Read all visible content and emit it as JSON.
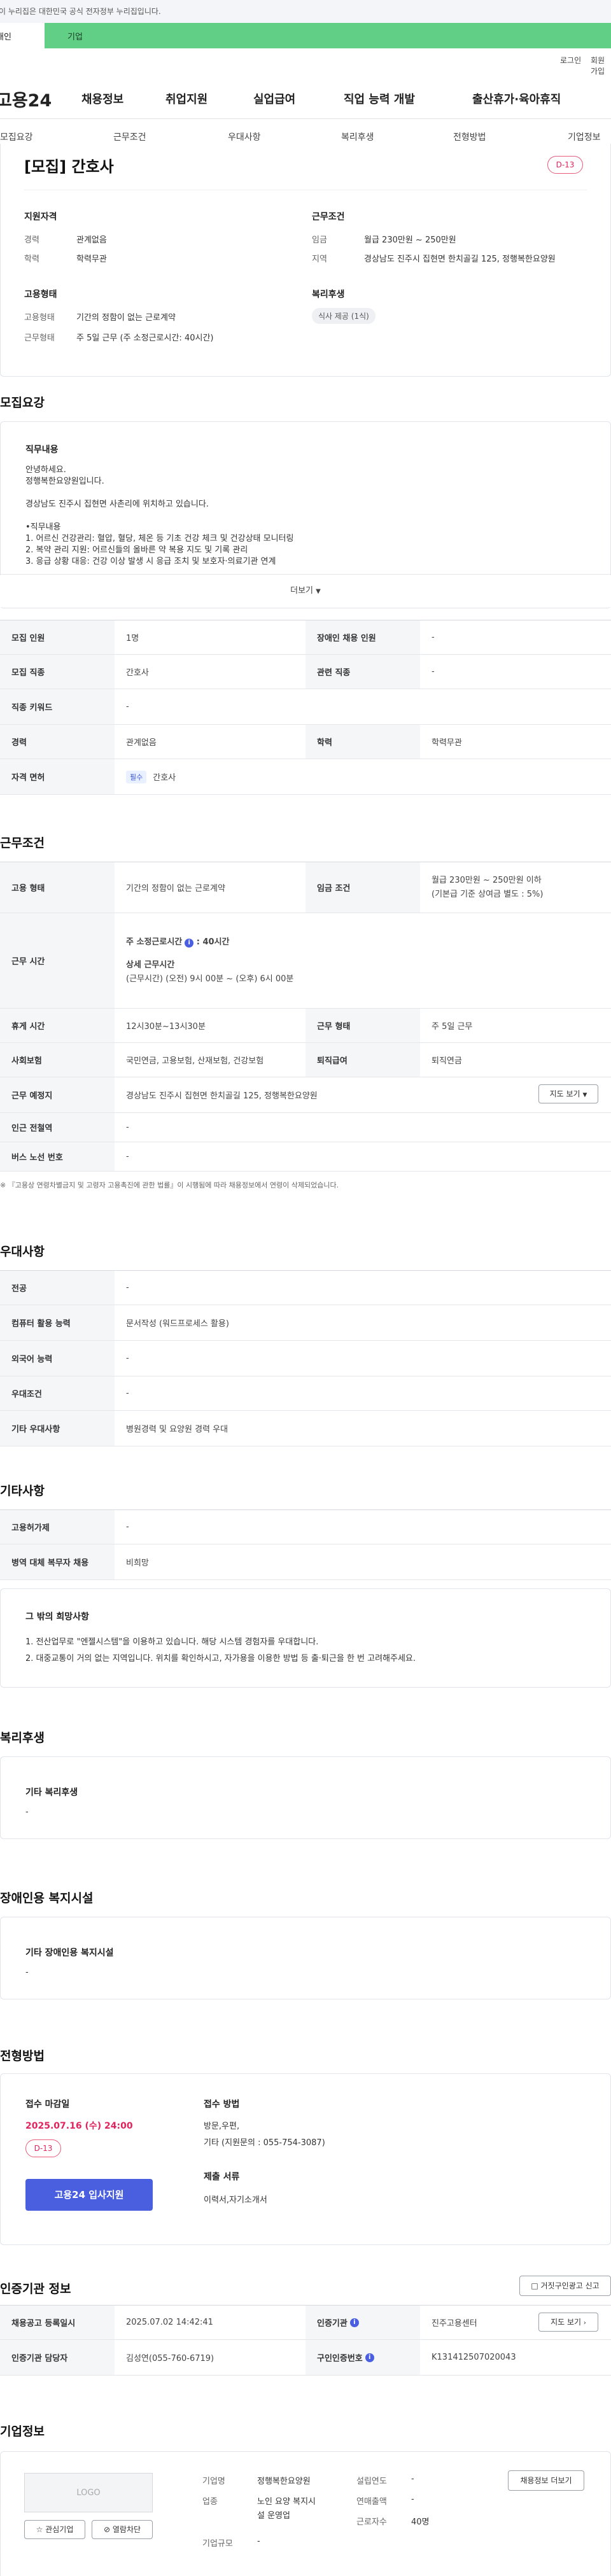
{
  "gov_bar": {
    "text": "이 누리집은 대한민국 공식 전자정부 누리집입니다."
  },
  "top_tabs": {
    "personal": "개인",
    "company": "기업"
  },
  "util_links": {
    "login": "로그인",
    "join": "회원가입"
  },
  "header": {
    "logo": "고용24",
    "gnb": [
      "채용정보",
      "취업지원",
      "실업급여",
      "직업 능력 개발",
      "출산휴가·육아휴직"
    ]
  },
  "subnav": [
    "모집요강",
    "근무조건",
    "우대사항",
    "복리후생",
    "전형방법",
    "기업정보"
  ],
  "summary": {
    "title": "[모집] 간호사",
    "dday": "D-13",
    "qualification_title": "지원자격",
    "career_label": "경력",
    "career_value": "관계없음",
    "edu_label": "학력",
    "edu_value": "학력무관",
    "work_title": "근무조건",
    "wage_label": "임금",
    "wage_value": "월급 230만원 ~ 250만원",
    "region_label": "지역",
    "region_value": "경상남도 진주시 집현면 한치골길 125, 정행복한요양원",
    "employ_title": "고용형태",
    "employ_type_label": "고용형태",
    "employ_type_value": "기간의 정함이 없는 근로계약",
    "work_form_label": "근무형태",
    "work_form_value": "주 5일 근무 (주 소정근로시간: 40시간)",
    "welfare_title": "복리후생",
    "welfare_tag": "식사 제공 (1식)"
  },
  "recruit": {
    "section_title": "모집요강",
    "job_content_title": "직무내용",
    "job_lines": [
      "안녕하세요.",
      "정행복한요양원입니다.",
      "",
      "경상남도 진주시 집현면 사촌리에 위치하고 있습니다.",
      "",
      "•직무내용",
      "1. 어르신 건강관리: 혈압, 혈당, 체온 등 기초 건강 체크 및 건강상태 모니터링",
      "2. 복약 관리 지원: 어르신들의 올바른 약 복용 지도 및 기록 관리",
      "3. 응급 상황 대응: 건강 이상 발생 시 응급 조치 및 보호자·의료기관 연계"
    ],
    "more_label": "더보기",
    "table": [
      {
        "h1": "모집 인원",
        "v1": "1명",
        "h2": "장애인 채용 인원",
        "v2": "-"
      },
      {
        "h1": "모집 직종",
        "v1": "간호사",
        "h2": "관련 직종",
        "v2": "-"
      },
      {
        "h1": "직종 키워드",
        "v1": "-"
      },
      {
        "h1": "경력",
        "v1": "관계없음",
        "h2": "학력",
        "v2": "학력무관"
      },
      {
        "h1": "자격 면허",
        "v1": "간호사",
        "badge": "필수"
      }
    ]
  },
  "conditions": {
    "section_title": "근무조건",
    "employ_form_h": "고용 형태",
    "employ_form_v": "기간의 정함이 없는 근로계약",
    "wage_h": "임금 조건",
    "wage_v1": "월급 230만원 ~ 250만원 이하",
    "wage_v2": "(기본급 기준 상여금 별도 : 5%)",
    "time_h": "근무 시간",
    "time_v1": "주 소정근로시간",
    "time_v1b": ": 40시간",
    "time_v2": "상세 근무시간",
    "time_v3": "(근무시간) (오전) 9시 00분 ~ (오후) 6시 00분",
    "rest_h": "휴게 시간",
    "rest_v": "12시30분~13시30분",
    "form_h": "근무 형태",
    "form_v": "주 5일 근무",
    "insure_h": "사회보험",
    "insure_v": "국민연금, 고용보험, 산재보험, 건강보험",
    "retire_h": "퇴직급여",
    "retire_v": "퇴직연금",
    "place_h": "근무 예정지",
    "place_v": "경상남도 진주시 집현면 한치골길 125, 정행복한요양원",
    "map_btn": "지도 보기",
    "station_h": "인근 전철역",
    "station_v": "-",
    "bus_h": "버스 노선 번호",
    "bus_v": "-",
    "note": "※ 『고용상 연령차별금지 및 고령자 고용촉진에 관한 법률』이 시행됨에 따라 채용정보에서 연령이 삭제되었습니다."
  },
  "preference": {
    "section_title": "우대사항",
    "rows": [
      {
        "h": "전공",
        "v": "-"
      },
      {
        "h": "컴퓨터 활용 능력",
        "v": "문서작성 (워드프로세스 활용)"
      },
      {
        "h": "외국어 능력",
        "v": "-"
      },
      {
        "h": "우대조건",
        "v": "-"
      },
      {
        "h": "기타 우대사항",
        "v": "병원경력 및 요양원 경력 우대"
      }
    ]
  },
  "etc": {
    "section_title": "기타사항",
    "rows": [
      {
        "h": "고용허가제",
        "v": "-"
      },
      {
        "h": "병역 대체 복무자 채용",
        "v": "비희망"
      }
    ],
    "box_title": "그 밖의 희망사항",
    "box_lines": [
      "1. 전산업무로 \"엔젤시스템\"을 이용하고 있습니다. 해당 시스템 경험자를 우대합니다.",
      "2. 대중교통이 거의 없는 지역입니다. 위치를 확인하시고, 자가용을 이용한 방법 등 출·퇴근을 한 번 고려해주세요."
    ]
  },
  "welfare": {
    "section_title": "복리후생",
    "box_title": "기타 복리후생",
    "box_value": "-"
  },
  "disability": {
    "section_title": "장애인용 복지시설",
    "box_title": "기타 장애인용 복지시설",
    "box_value": "-"
  },
  "selection": {
    "section_title": "전형방법",
    "deadline_label": "접수 마감일",
    "deadline_value": "2025.07.16 (수) 24:00",
    "dday": "D-13",
    "apply_btn": "고용24 입사지원",
    "method_label": "접수 방법",
    "method_v1": "방문,우편,",
    "method_v2": "기타 (지원문의 : 055-754-3087)",
    "docs_label": "제출 서류",
    "docs_value": "이력서,자기소개서"
  },
  "agency": {
    "section_title": "인증기관 정보",
    "report_btn": "거짓구인광고 신고",
    "reg_date_h": "채용공고 등록일시",
    "reg_date_v": "2025.07.02 14:42:41",
    "agency_h": "인증기관",
    "agency_v": "진주고용센터",
    "manager_h": "인증기관 담당자",
    "manager_v": "김성연(055-760-6719)",
    "offer_h": "구인인증번호",
    "offer_v": "K131412507020043",
    "map_btn": "지도 보기"
  },
  "company": {
    "section_title": "기업정보",
    "logo_text": "LOGO",
    "fav_btn": "관심기업",
    "block_btn": "열람차단",
    "name_label": "기업명",
    "name_value": "정행복한요양원",
    "industry_label": "업종",
    "industry_v1": "노인 요양 복지시",
    "industry_v2": "설 운영업",
    "size_label": "기업규모",
    "size_value": "-",
    "founded_label": "설립연도",
    "founded_value": "-",
    "sales_label": "연매출액",
    "sales_value": "-",
    "emp_label": "근로자수",
    "emp_value": "40명",
    "jobs_btn": "채용정보 더보기"
  }
}
